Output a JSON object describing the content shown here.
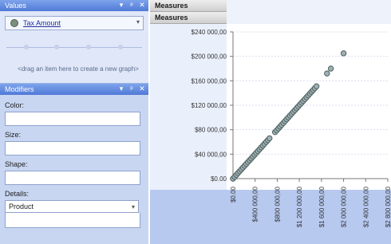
{
  "values_panel": {
    "title": "Values",
    "item_label": "Tax Amount",
    "hint": "<drag an item here to create a new graph>"
  },
  "modifiers_panel": {
    "title": "Modifiers",
    "color_label": "Color:",
    "size_label": "Size:",
    "shape_label": "Shape:",
    "details_label": "Details:",
    "details_value": "Product"
  },
  "measures": [
    "Measures",
    "Measures"
  ],
  "panel_controls": [
    "▾",
    "ᵖ",
    "✕"
  ],
  "chart_data": {
    "type": "scatter",
    "y_ticks": [
      "$240 000,00",
      "$200 000,00",
      "$160 000,00",
      "$120 000,00",
      "$80 000,00",
      "$40 000,00",
      "$0.00"
    ],
    "x_ticks": [
      "$0.00",
      "$400 000,00",
      "$800 000,00",
      "$1 200 000,00",
      "$1 600 000,00",
      "$2 000 000,00",
      "$2 400 000,00",
      "$2 800 000,00"
    ],
    "ylim": [
      0,
      240000
    ],
    "xlim": [
      0,
      2800000
    ],
    "points": [
      [
        0,
        0
      ],
      [
        30000,
        3000
      ],
      [
        60000,
        6000
      ],
      [
        90000,
        9000
      ],
      [
        120000,
        12000
      ],
      [
        150000,
        15000
      ],
      [
        180000,
        18000
      ],
      [
        210000,
        21000
      ],
      [
        240000,
        24000
      ],
      [
        270000,
        27000
      ],
      [
        300000,
        30000
      ],
      [
        330000,
        33000
      ],
      [
        360000,
        36000
      ],
      [
        390000,
        39000
      ],
      [
        420000,
        42000
      ],
      [
        450000,
        45000
      ],
      [
        480000,
        48000
      ],
      [
        510000,
        51000
      ],
      [
        540000,
        54000
      ],
      [
        570000,
        57000
      ],
      [
        600000,
        60000
      ],
      [
        630000,
        63000
      ],
      [
        660000,
        66000
      ],
      [
        760000,
        76000
      ],
      [
        790000,
        79000
      ],
      [
        820000,
        82000
      ],
      [
        850000,
        85000
      ],
      [
        880000,
        88000
      ],
      [
        910000,
        91000
      ],
      [
        940000,
        94000
      ],
      [
        970000,
        97000
      ],
      [
        1000000,
        100000
      ],
      [
        1030000,
        103000
      ],
      [
        1060000,
        106000
      ],
      [
        1090000,
        109000
      ],
      [
        1120000,
        112000
      ],
      [
        1150000,
        115000
      ],
      [
        1180000,
        118000
      ],
      [
        1210000,
        121000
      ],
      [
        1240000,
        124000
      ],
      [
        1270000,
        127000
      ],
      [
        1300000,
        130000
      ],
      [
        1330000,
        133000
      ],
      [
        1360000,
        136000
      ],
      [
        1390000,
        139000
      ],
      [
        1420000,
        142000
      ],
      [
        1450000,
        145000
      ],
      [
        1480000,
        148000
      ],
      [
        1510000,
        151000
      ],
      [
        1700000,
        172000
      ],
      [
        1770000,
        180000
      ],
      [
        2000000,
        205000
      ]
    ],
    "grid": true
  }
}
